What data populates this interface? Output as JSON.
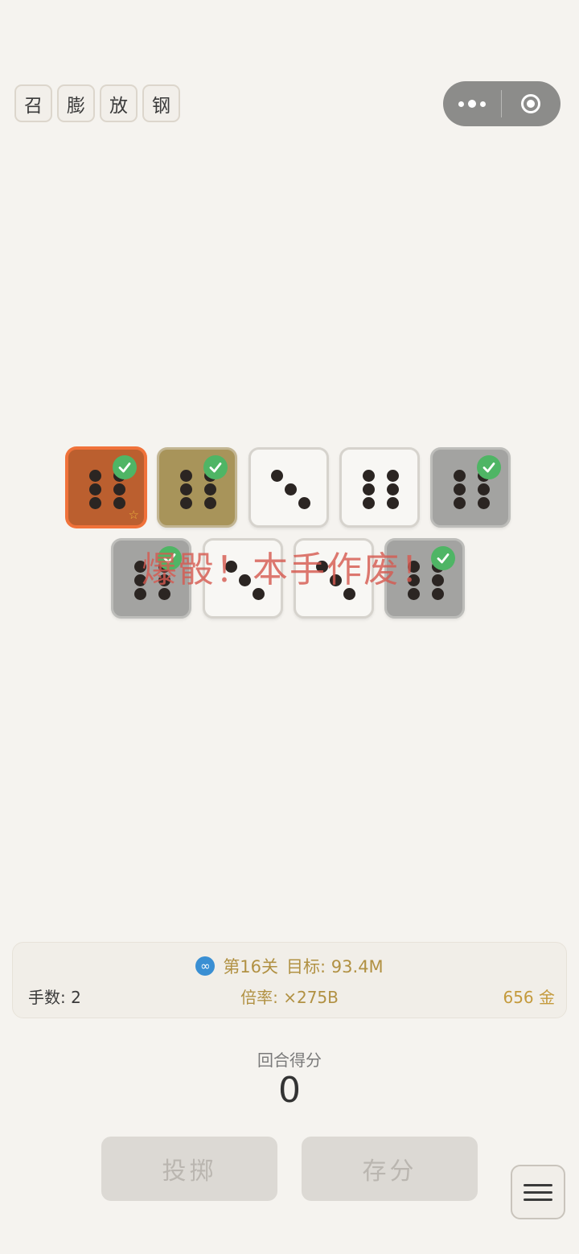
{
  "tags": [
    "召",
    "膨",
    "放",
    "钢"
  ],
  "capsule": {
    "more_icon": "more-dots-icon",
    "close_icon": "target-circle-icon"
  },
  "dice": [
    {
      "value": 6,
      "state": "fire",
      "held": true,
      "starred": true
    },
    {
      "value": 6,
      "state": "olive",
      "held": true
    },
    {
      "value": 3,
      "state": "normal",
      "held": false
    },
    {
      "value": 6,
      "state": "normal",
      "held": false
    },
    {
      "value": 6,
      "state": "grey",
      "held": true
    },
    {
      "value": 6,
      "state": "grey",
      "held": true
    },
    {
      "value": 3,
      "state": "normal",
      "held": false
    },
    {
      "value": 3,
      "state": "normal",
      "held": false
    },
    {
      "value": 6,
      "state": "grey",
      "held": true
    }
  ],
  "overlay_text": "爆骰！本手作废！",
  "status": {
    "level": "第16关",
    "target": "目标: 93.4M",
    "hands": "手数: 2",
    "multiplier": "倍率: ×275B",
    "gold": "656 金",
    "mode_icon": "infinity-icon"
  },
  "round": {
    "label": "回合得分",
    "score": "0"
  },
  "buttons": {
    "roll": "投掷",
    "bank": "存分"
  },
  "colors": {
    "accent": "#b19143",
    "check": "#4fb565",
    "bust_text": "#d65a50",
    "fire": "#bb5f2f"
  }
}
